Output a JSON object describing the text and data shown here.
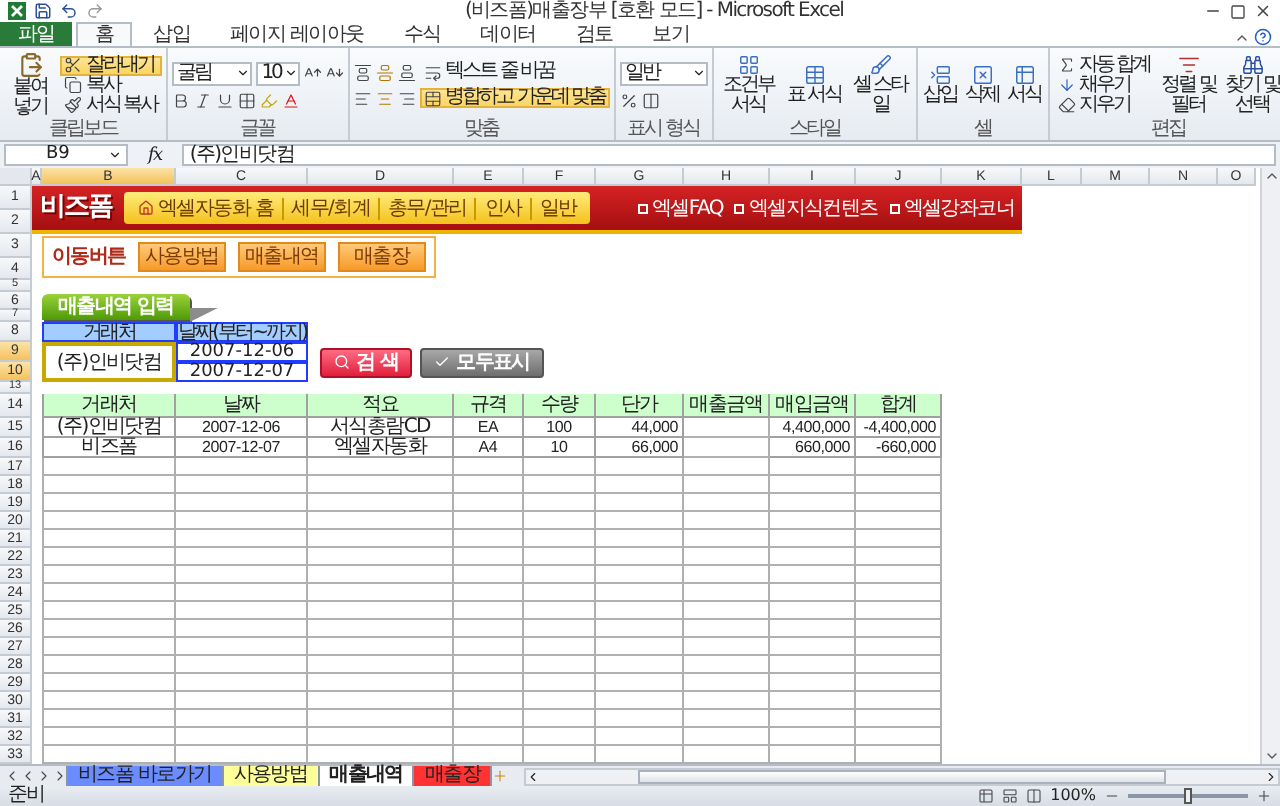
{
  "window": {
    "title": "(비즈폼)매출장부 [호환 모드] - Microsoft Excel"
  },
  "ribbon_tabs": [
    {
      "label": "파일",
      "kind": "file",
      "selected": false
    },
    {
      "label": "홈",
      "kind": "tab",
      "selected": true
    },
    {
      "label": "삽입",
      "kind": "tab",
      "selected": false
    },
    {
      "label": "페이지 레이아웃",
      "kind": "tab",
      "selected": false
    },
    {
      "label": "수식",
      "kind": "tab",
      "selected": false
    },
    {
      "label": "데이터",
      "kind": "tab",
      "selected": false
    },
    {
      "label": "검토",
      "kind": "tab",
      "selected": false
    },
    {
      "label": "보기",
      "kind": "tab",
      "selected": false
    }
  ],
  "ribbon": {
    "clipboard": {
      "label": "클립보드",
      "paste": "붙여넣기",
      "cut": {
        "label": "잘라내기",
        "active": true
      },
      "copy": {
        "label": "복사",
        "active": false
      },
      "format_painter": {
        "label": "서식 복사",
        "active": false
      }
    },
    "font": {
      "label": "글꼴",
      "name": "굴림",
      "size": "10"
    },
    "alignment": {
      "label": "맞춤",
      "wrap_text": {
        "label": "텍스트 줄 바꿈",
        "active": false
      },
      "merge_center": {
        "label": "병합하고 가운데 맞춤",
        "active": true
      }
    },
    "number": {
      "label": "표시 형식",
      "format": "일반"
    },
    "styles": {
      "label": "스타일",
      "buttons": [
        "조건부 서식",
        "표 서식",
        "셀 스타일"
      ]
    },
    "cells": {
      "label": "셀",
      "buttons": [
        "삽입",
        "삭제",
        "서식"
      ]
    },
    "editing": {
      "label": "편집",
      "autosum": "자동 합계",
      "fill": "채우기",
      "clear": "지우기",
      "sort_filter": "정렬 및 필터",
      "find_select": "찾기 및 선택"
    }
  },
  "formula_bar": {
    "name_box": "B9",
    "fx": "fx",
    "content": "(주)인비닷컴"
  },
  "columns": [
    {
      "label": "A",
      "selected": false
    },
    {
      "label": "B",
      "selected": true
    },
    {
      "label": "C",
      "selected": false
    },
    {
      "label": "D",
      "selected": false
    },
    {
      "label": "E",
      "selected": false
    },
    {
      "label": "F",
      "selected": false
    },
    {
      "label": "G",
      "selected": false
    },
    {
      "label": "H",
      "selected": false
    },
    {
      "label": "I",
      "selected": false
    },
    {
      "label": "J",
      "selected": false
    },
    {
      "label": "K",
      "selected": false
    },
    {
      "label": "L",
      "selected": false
    },
    {
      "label": "M",
      "selected": false
    },
    {
      "label": "N",
      "selected": false
    },
    {
      "label": "O",
      "selected": false
    }
  ],
  "rows": [
    {
      "label": "1",
      "selected": false
    },
    {
      "label": "2",
      "selected": false
    },
    {
      "label": "3",
      "selected": false
    },
    {
      "label": "4",
      "selected": false
    },
    {
      "label": "5",
      "selected": false
    },
    {
      "label": "6",
      "selected": false
    },
    {
      "label": "7",
      "selected": false
    },
    {
      "label": "8",
      "selected": false
    },
    {
      "label": "9",
      "selected": true
    },
    {
      "label": "10",
      "selected": true
    },
    {
      "label": "13",
      "selected": false
    },
    {
      "label": "14",
      "selected": false
    },
    {
      "label": "15",
      "selected": false
    },
    {
      "label": "16",
      "selected": false
    },
    {
      "label": "17",
      "selected": false
    },
    {
      "label": "18",
      "selected": false
    },
    {
      "label": "19",
      "selected": false
    },
    {
      "label": "20",
      "selected": false
    },
    {
      "label": "21",
      "selected": false
    },
    {
      "label": "22",
      "selected": false
    },
    {
      "label": "23",
      "selected": false
    },
    {
      "label": "24",
      "selected": false
    },
    {
      "label": "25",
      "selected": false
    },
    {
      "label": "26",
      "selected": false
    },
    {
      "label": "27",
      "selected": false
    },
    {
      "label": "28",
      "selected": false
    },
    {
      "label": "29",
      "selected": false
    },
    {
      "label": "30",
      "selected": false
    },
    {
      "label": "31",
      "selected": false
    },
    {
      "label": "32",
      "selected": false
    },
    {
      "label": "33",
      "selected": false
    }
  ],
  "banner": {
    "logo": "비즈폼",
    "nav": [
      {
        "label": "엑셀자동화 홈",
        "kind": "home"
      },
      {
        "label": "세무/회계",
        "kind": "link"
      },
      {
        "label": "총무/관리",
        "kind": "link"
      },
      {
        "label": "인사",
        "kind": "link"
      },
      {
        "label": "일반",
        "kind": "link"
      }
    ],
    "links": [
      "엑셀FAQ",
      "엑셀지식컨텐츠",
      "엑셀강좌코너"
    ]
  },
  "nav_buttons": {
    "label": "이동버튼",
    "buttons": [
      "사용방법",
      "매출내역",
      "매출장"
    ]
  },
  "section_title": "매출내역 입력",
  "search": {
    "client_header": "거래처",
    "date_header": "날짜(부터~까지)",
    "client": "(주)인비닷컴",
    "date_from": "2007-12-06",
    "date_to": "2007-12-07",
    "search_button": "검 색",
    "show_all_button": "모두표시"
  },
  "table": {
    "columns": [
      "거래처",
      "날짜",
      "적요",
      "규격",
      "수량",
      "단가",
      "매출금액",
      "매입금액",
      "합계"
    ],
    "rows": [
      [
        "(주)인비닷컴",
        "2007-12-06",
        "서식총람CD",
        "EA",
        "100",
        "44,000",
        "",
        "4,400,000",
        "-4,400,000"
      ],
      [
        "비즈폼",
        "2007-12-07",
        "엑셀자동화",
        "A4",
        "10",
        "66,000",
        "",
        "660,000",
        "-660,000"
      ]
    ]
  },
  "sheet_tabs": [
    {
      "label": "비즈폼 바로가기",
      "selected": false,
      "color": "#6b8cff"
    },
    {
      "label": "사용방법",
      "selected": false,
      "color": "#ffff99"
    },
    {
      "label": "매출내역",
      "selected": true
    },
    {
      "label": "매출장",
      "selected": false,
      "color": "#ff3333"
    }
  ],
  "status_bar": {
    "text": "준비",
    "zoom": {
      "label": "100%",
      "level": 0.5
    }
  }
}
